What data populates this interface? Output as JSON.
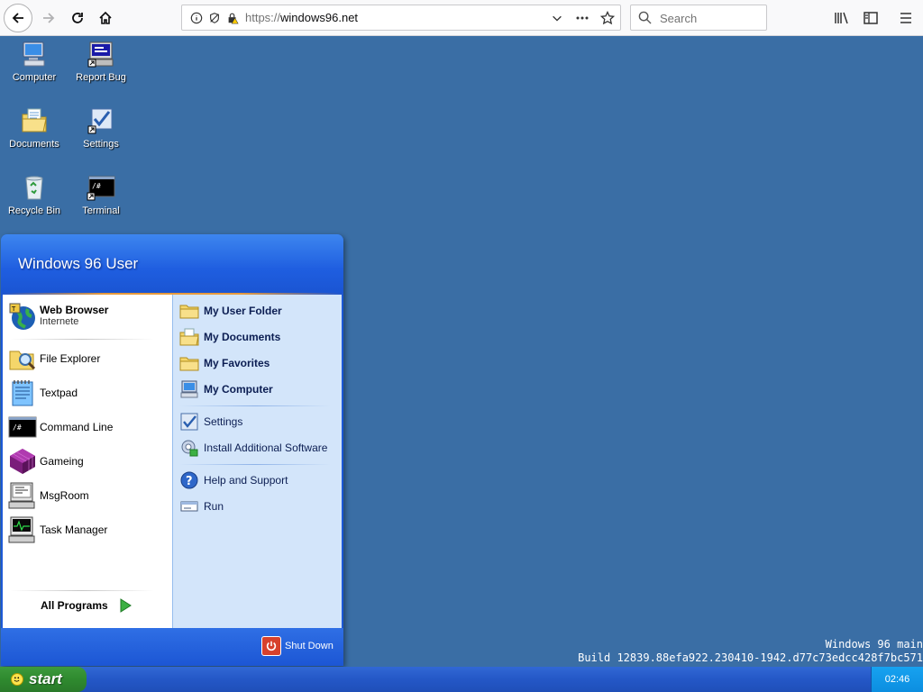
{
  "browser": {
    "url_prefix": "https://",
    "url_host": "windows96.net",
    "search_placeholder": "Search"
  },
  "desktop_icons": [
    {
      "label": "Computer",
      "icon": "computer-icon"
    },
    {
      "label": "Report Bug",
      "icon": "report-bug-icon"
    },
    {
      "label": "Documents",
      "icon": "documents-icon"
    },
    {
      "label": "Settings",
      "icon": "settings-icon"
    },
    {
      "label": "Recycle Bin",
      "icon": "recycle-bin-icon"
    },
    {
      "label": "Terminal",
      "icon": "terminal-icon"
    }
  ],
  "start_menu": {
    "user_name": "Windows 96 User",
    "pinned": {
      "title": "Web Browser",
      "subtitle": "Internete",
      "icon": "web-browser-icon"
    },
    "left_items": [
      {
        "label": "File Explorer",
        "icon": "file-explorer-icon"
      },
      {
        "label": "Textpad",
        "icon": "textpad-icon"
      },
      {
        "label": "Command Line",
        "icon": "command-line-icon"
      },
      {
        "label": "Gameing",
        "icon": "gameing-icon"
      },
      {
        "label": "MsgRoom",
        "icon": "msgroom-icon"
      },
      {
        "label": "Task Manager",
        "icon": "task-manager-icon"
      }
    ],
    "all_programs": "All Programs",
    "right_items": [
      {
        "label": "My User Folder",
        "icon": "folder-icon"
      },
      {
        "label": "My Documents",
        "icon": "folder-icon"
      },
      {
        "label": "My Favorites",
        "icon": "folder-icon"
      },
      {
        "label": "My Computer",
        "icon": "computer-icon"
      },
      {
        "label": "Settings",
        "icon": "settings-icon"
      },
      {
        "label": "Install Additional Software",
        "icon": "install-icon"
      },
      {
        "label": "Help and Support",
        "icon": "help-icon"
      },
      {
        "label": "Run",
        "icon": "run-icon"
      }
    ],
    "shutdown": "Shut Down"
  },
  "build_info": {
    "line1": "Windows 96 main",
    "line2": "Build 12839.88efa922.230410-1942.d77c73edcc428f7bc571"
  },
  "taskbar": {
    "start_label": "start",
    "clock": "02:46"
  },
  "colors": {
    "desktop": "#3a6ea5",
    "taskbar": "#2457c7",
    "start_button": "#2f8a2f",
    "menu_header": "#1f5ee0",
    "menu_right_panel": "#d3e5fa"
  }
}
